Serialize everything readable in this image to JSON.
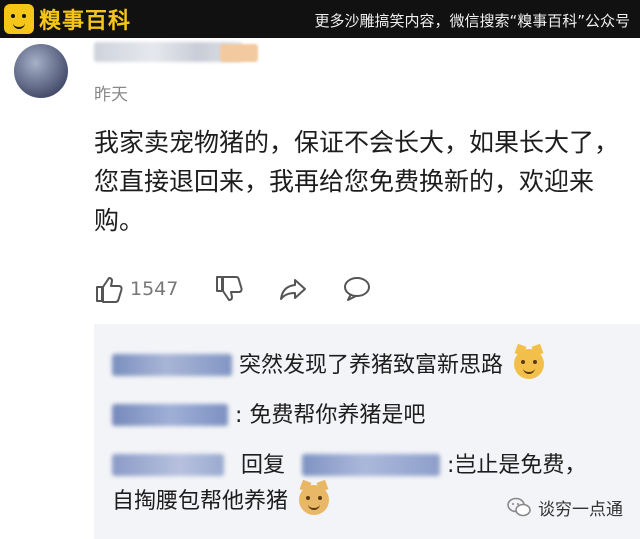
{
  "banner": {
    "logo_text": "糗事百科",
    "promo_text": "更多沙雕搞笑内容，微信搜索“糗事百科”公众号"
  },
  "comment": {
    "time": "昨天",
    "content": "我家卖宠物猪的，保证不会长大，如果长大了，您直接退回来，我再给您免费换新的，欢迎来购。",
    "like_count": "1547"
  },
  "replies": [
    {
      "text": "突然发现了养猪致富新思路"
    },
    {
      "text": ": 免费帮你养猪是吧"
    },
    {
      "reply_word": "回复",
      "text_line1": ":岂止是免费，",
      "text_line2": "自掏腰包帮他养猪"
    }
  ],
  "watermark": {
    "text": "谈穷一点通"
  },
  "icons": [
    "thumbs-up-icon",
    "thumbs-down-icon",
    "share-icon",
    "comment-icon",
    "cat-emoji-icon",
    "dog-emoji-icon",
    "wechat-icon"
  ]
}
